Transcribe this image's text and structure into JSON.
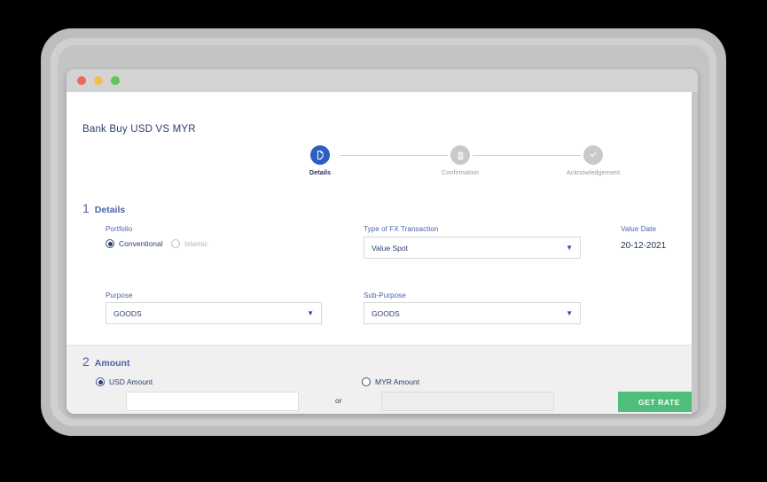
{
  "window": {
    "traffic_lights": [
      "close",
      "minimize",
      "maximize"
    ]
  },
  "page": {
    "title": "Bank Buy USD VS MYR"
  },
  "stepper": {
    "steps": [
      {
        "label": "Details",
        "icon": "document-icon",
        "state": "active"
      },
      {
        "label": "Confirmation",
        "icon": "clipboard-icon",
        "state": "inactive"
      },
      {
        "label": "Acknowledgement",
        "icon": "check-icon",
        "state": "inactive"
      }
    ]
  },
  "details": {
    "number": "1",
    "heading": "Details",
    "portfolio": {
      "label": "Portfolio",
      "options": [
        {
          "label": "Conventional",
          "checked": true,
          "disabled": false
        },
        {
          "label": "Islamic",
          "checked": false,
          "disabled": true
        }
      ]
    },
    "fx_type": {
      "label": "Type of FX Transaction",
      "value": "Value Spot"
    },
    "value_date": {
      "label": "Value Date",
      "value": "20-12-2021"
    },
    "purpose": {
      "label": "Purpose",
      "value": "GOODS"
    },
    "sub_purpose": {
      "label": "Sub-Purpose",
      "value": "GOODS"
    }
  },
  "amount": {
    "number": "2",
    "heading": "Amount",
    "usd": {
      "label": "USD Amount",
      "checked": true,
      "value": "",
      "placeholder": ""
    },
    "myr": {
      "label": "MYR Amount",
      "checked": false,
      "value": "",
      "placeholder": "",
      "disabled": true
    },
    "separator": "or",
    "get_rate_label": "GET RATE"
  },
  "colors": {
    "accent_blue": "#2f5fc0",
    "label_blue": "#4a62a8",
    "title_navy": "#2b3f73",
    "button_green": "#4fbe7b",
    "inactive_gray": "#c9c9c9"
  }
}
